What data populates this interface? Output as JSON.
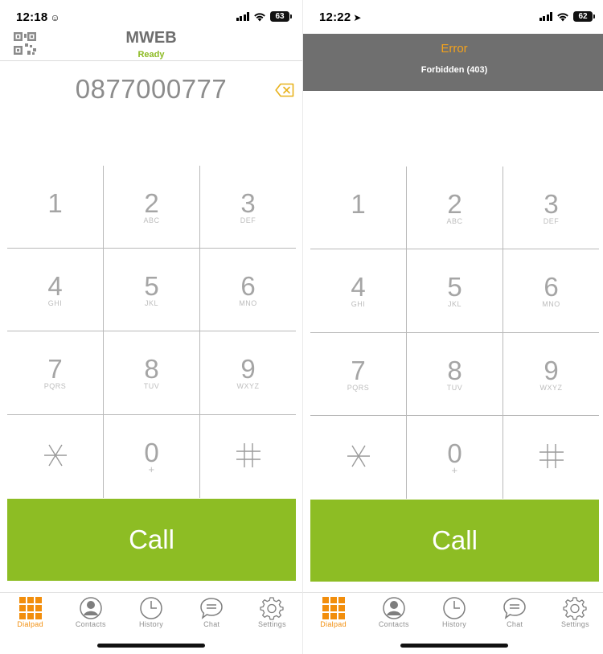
{
  "screens": [
    {
      "status_bar": {
        "time": "12:18",
        "time_glyph": "☺",
        "battery": "63"
      },
      "header": {
        "title": "MWEB",
        "status": "Ready"
      },
      "dialed_number": "0877000777",
      "keys": [
        {
          "digit": "1",
          "letters": ""
        },
        {
          "digit": "2",
          "letters": "ABC"
        },
        {
          "digit": "3",
          "letters": "DEF"
        },
        {
          "digit": "4",
          "letters": "GHI"
        },
        {
          "digit": "5",
          "letters": "JKL"
        },
        {
          "digit": "6",
          "letters": "MNO"
        },
        {
          "digit": "7",
          "letters": "PQRS"
        },
        {
          "digit": "8",
          "letters": "TUV"
        },
        {
          "digit": "9",
          "letters": "WXYZ"
        },
        {
          "digit": "*",
          "letters": ""
        },
        {
          "digit": "0",
          "letters": "+"
        },
        {
          "digit": "#",
          "letters": ""
        }
      ],
      "call_label": "Call",
      "tabs": [
        {
          "label": "Dialpad",
          "icon": "dialpad-icon",
          "active": true
        },
        {
          "label": "Contacts",
          "icon": "contacts-icon",
          "active": false
        },
        {
          "label": "History",
          "icon": "history-icon",
          "active": false
        },
        {
          "label": "Chat",
          "icon": "chat-icon",
          "active": false
        },
        {
          "label": "Settings",
          "icon": "settings-icon",
          "active": false
        }
      ]
    },
    {
      "status_bar": {
        "time": "12:22",
        "time_glyph": "➤",
        "battery": "62"
      },
      "error": {
        "title": "Error",
        "message": "Forbidden (403)"
      },
      "keys": [
        {
          "digit": "1",
          "letters": ""
        },
        {
          "digit": "2",
          "letters": "ABC"
        },
        {
          "digit": "3",
          "letters": "DEF"
        },
        {
          "digit": "4",
          "letters": "GHI"
        },
        {
          "digit": "5",
          "letters": "JKL"
        },
        {
          "digit": "6",
          "letters": "MNO"
        },
        {
          "digit": "7",
          "letters": "PQRS"
        },
        {
          "digit": "8",
          "letters": "TUV"
        },
        {
          "digit": "9",
          "letters": "WXYZ"
        },
        {
          "digit": "*",
          "letters": ""
        },
        {
          "digit": "0",
          "letters": "+"
        },
        {
          "digit": "#",
          "letters": ""
        }
      ],
      "call_label": "Call",
      "tabs": [
        {
          "label": "Dialpad",
          "icon": "dialpad-icon",
          "active": true
        },
        {
          "label": "Contacts",
          "icon": "contacts-icon",
          "active": false
        },
        {
          "label": "History",
          "icon": "history-icon",
          "active": false
        },
        {
          "label": "Chat",
          "icon": "chat-icon",
          "active": false
        },
        {
          "label": "Settings",
          "icon": "settings-icon",
          "active": false
        }
      ]
    }
  ],
  "colors": {
    "accent_green": "#8dbd24",
    "ready_green": "#8cba22",
    "active_orange": "#f28e0c",
    "error_orange": "#f4a21b",
    "error_banner": "#6f6f6f"
  }
}
